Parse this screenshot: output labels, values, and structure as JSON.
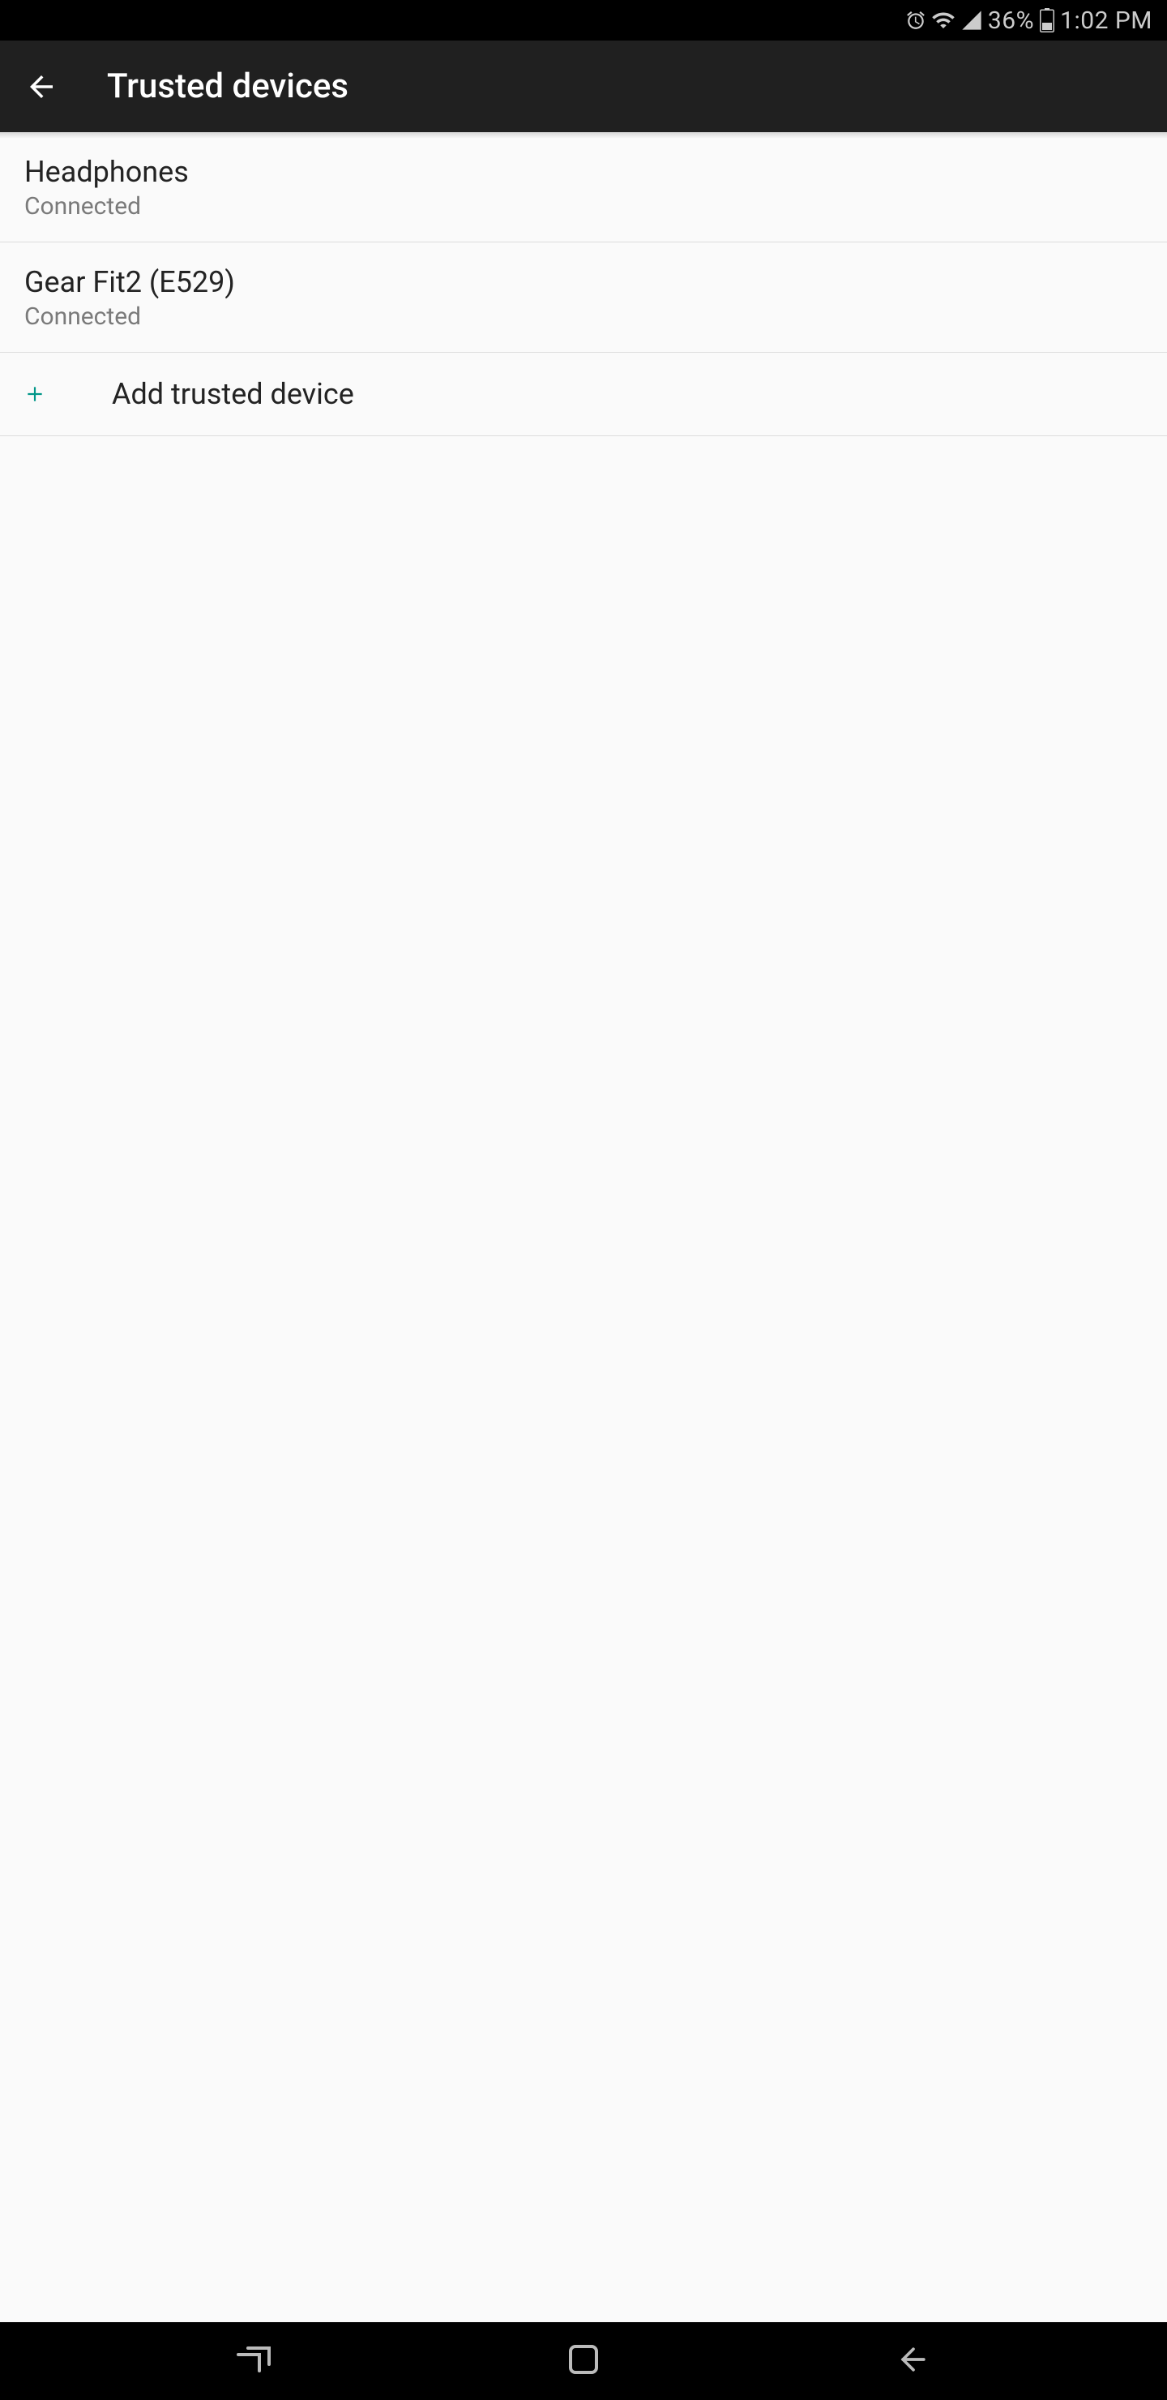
{
  "status_bar": {
    "battery_percent": "36%",
    "time": "1:02 PM"
  },
  "app_bar": {
    "title": "Trusted devices"
  },
  "devices": [
    {
      "name": "Headphones",
      "status": "Connected"
    },
    {
      "name": "Gear Fit2 (E529)",
      "status": "Connected"
    }
  ],
  "add_device": {
    "label": "Add trusted device"
  },
  "colors": {
    "accent": "#009688"
  }
}
